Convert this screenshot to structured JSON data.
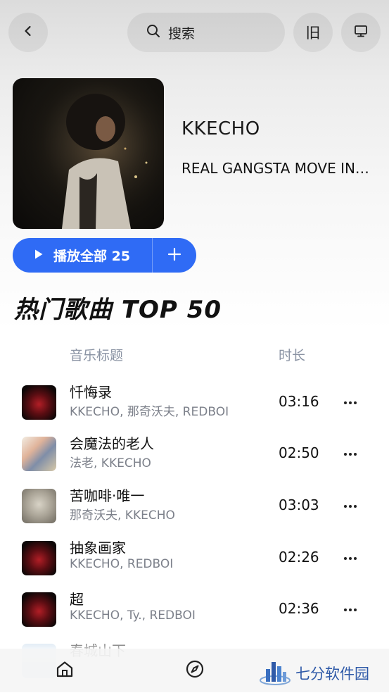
{
  "header": {
    "search_label": "搜索",
    "mode_button_label": "旧"
  },
  "album": {
    "artist": "KKECHO",
    "title": "REAL GANGSTA MOVE IN…",
    "play_all_label": "播放全部 25"
  },
  "section": {
    "title": "热门歌曲 TOP 50",
    "col_title": "音乐标题",
    "col_duration": "时长"
  },
  "songs": [
    {
      "title": "忏悔录",
      "artists": "KKECHO, 那奇沃夫, REDBOI",
      "duration": "03:16"
    },
    {
      "title": "会魔法的老人",
      "artists": "法老, KKECHO",
      "duration": "02:50"
    },
    {
      "title": "苦咖啡·唯一",
      "artists": "那奇沃夫, KKECHO",
      "duration": "03:03"
    },
    {
      "title": "抽象画家",
      "artists": "KKECHO, REDBOI",
      "duration": "02:26"
    },
    {
      "title": "超",
      "artists": "KKECHO, Ty., REDBOI",
      "duration": "02:36"
    },
    {
      "title": "春城山下",
      "artists": "",
      "duration": ""
    }
  ],
  "watermark": {
    "text": "七分软件园"
  },
  "colors": {
    "accent": "#2f6bf5",
    "muted": "#8a93a3"
  }
}
